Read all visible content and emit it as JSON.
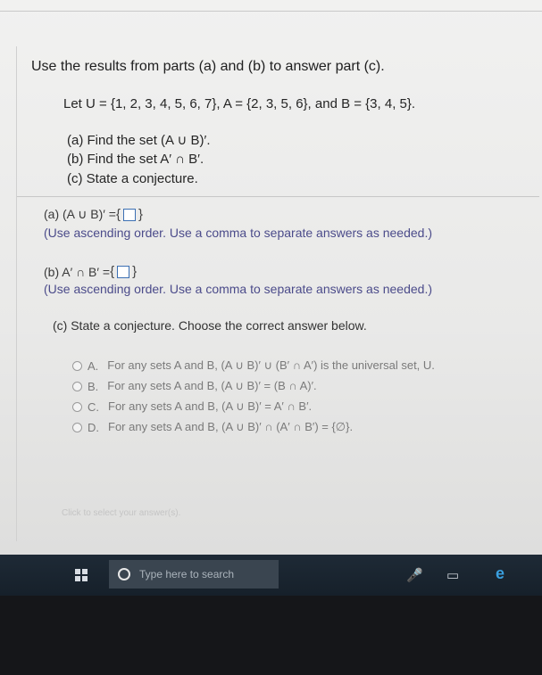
{
  "instruction": "Use the results from parts (a) and (b) to answer part (c).",
  "let_line": "Let U = {1, 2, 3, 4, 5, 6, 7}, A = {2, 3, 5, 6}, and B = {3, 4, 5}.",
  "tasks": [
    "(a) Find the set (A ∪ B)′.",
    "(b) Find the set A′ ∩ B′.",
    "(c) State a conjecture."
  ],
  "part_a": {
    "label": "(a) (A ∪ B)′ = ",
    "open": "{",
    "close": "}",
    "note": "(Use ascending order. Use a comma to separate answers as needed.)"
  },
  "part_b": {
    "label": "(b) A′ ∩ B′ = ",
    "open": "{",
    "close": "}",
    "note": "(Use ascending order. Use a comma to separate answers as needed.)"
  },
  "part_c_label": "(c) State a conjecture. Choose the correct answer below.",
  "options": [
    {
      "letter": "A.",
      "text": "For any sets A and B, (A ∪ B)′ ∪ (B′ ∩ A′) is the universal set, U."
    },
    {
      "letter": "B.",
      "text": "For any sets A and B, (A ∪ B)′ = (B ∩ A)′."
    },
    {
      "letter": "C.",
      "text": "For any sets A and B, (A ∪ B)′ = A′ ∩ B′."
    },
    {
      "letter": "D.",
      "text": "For any sets A and B, (A ∪ B)′ ∩ (A′ ∩ B′) = {∅}."
    }
  ],
  "click_hint": "Click to select your answer(s).",
  "taskbar": {
    "search_placeholder": "Type here to search"
  },
  "colors": {
    "taskbar": "#1e2a36",
    "answer_box_border": "#3b6fb3",
    "note_text": "#4b4b8a"
  },
  "icons": [
    "windows-start-icon",
    "search-icon",
    "microphone-icon",
    "task-view-icon",
    "edge-icon"
  ]
}
